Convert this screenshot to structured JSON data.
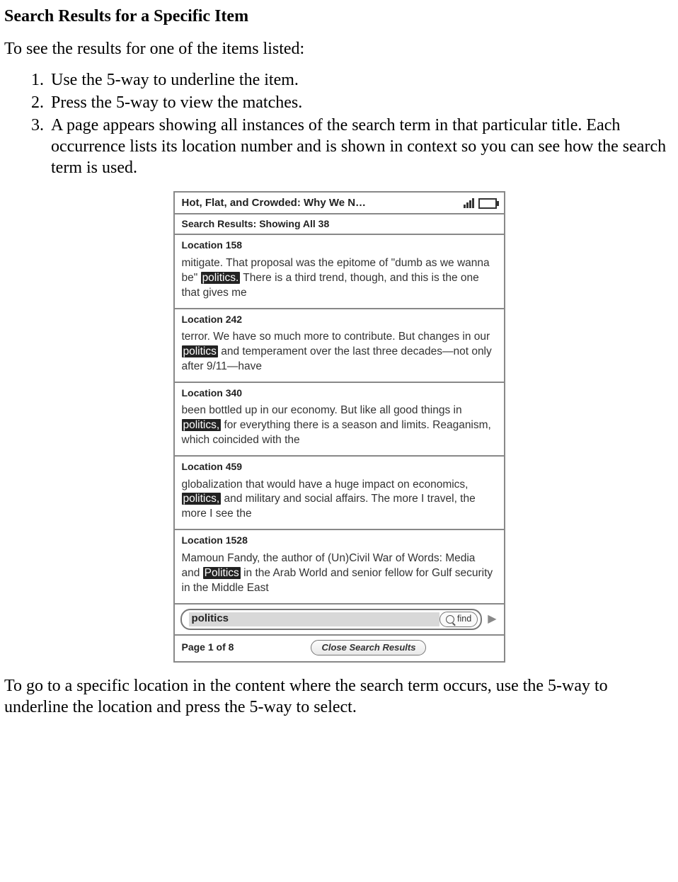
{
  "heading": "Search Results for a Specific Item",
  "intro": "To see the results for one of the items listed:",
  "steps": [
    "Use the 5-way to underline the item.",
    "Press the 5-way to view the matches.",
    "A page appears showing all instances of the search term in that particular title. Each occurrence lists its location number and is shown in context so you can see how the search term is used."
  ],
  "device": {
    "title": "Hot, Flat, and Crowded: Why We N…",
    "subheader": "Search Results: Showing All 38",
    "search_term": "politics",
    "find_label": "find",
    "close_label": "Close Search Results",
    "page_info": "Page 1 of 8",
    "results": [
      {
        "location_label": "Location 158",
        "pre": "mitigate. That proposal was the epitome of \"dumb as we wanna be\" ",
        "hl": "politics.",
        "post": " There is a third trend, though, and this is the one that gives me"
      },
      {
        "location_label": "Location 242",
        "pre": "terror. We have so much more to contribute. But changes in our ",
        "hl": "politics",
        "post": " and temperament over the last three decades—not only after 9/11—have"
      },
      {
        "location_label": "Location 340",
        "pre": "been bottled up in our economy. But like all good things in ",
        "hl": "politics,",
        "post": " for everything there is a season and limits. Reaganism, which coincided with the"
      },
      {
        "location_label": "Location 459",
        "pre": "globalization that would have a huge impact on economics, ",
        "hl": "politics,",
        "post": " and military and social affairs. The more I travel, the more I see the"
      },
      {
        "location_label": "Location 1528",
        "pre": "Mamoun Fandy, the author of (Un)Civil War of Words: Media and ",
        "hl": "Politics",
        "post": " in the Arab World and senior fellow for Gulf security in the Middle East"
      }
    ]
  },
  "outro": "To go to a specific location in the content where the search term occurs, use the 5-way to underline the location and press the 5-way to select."
}
